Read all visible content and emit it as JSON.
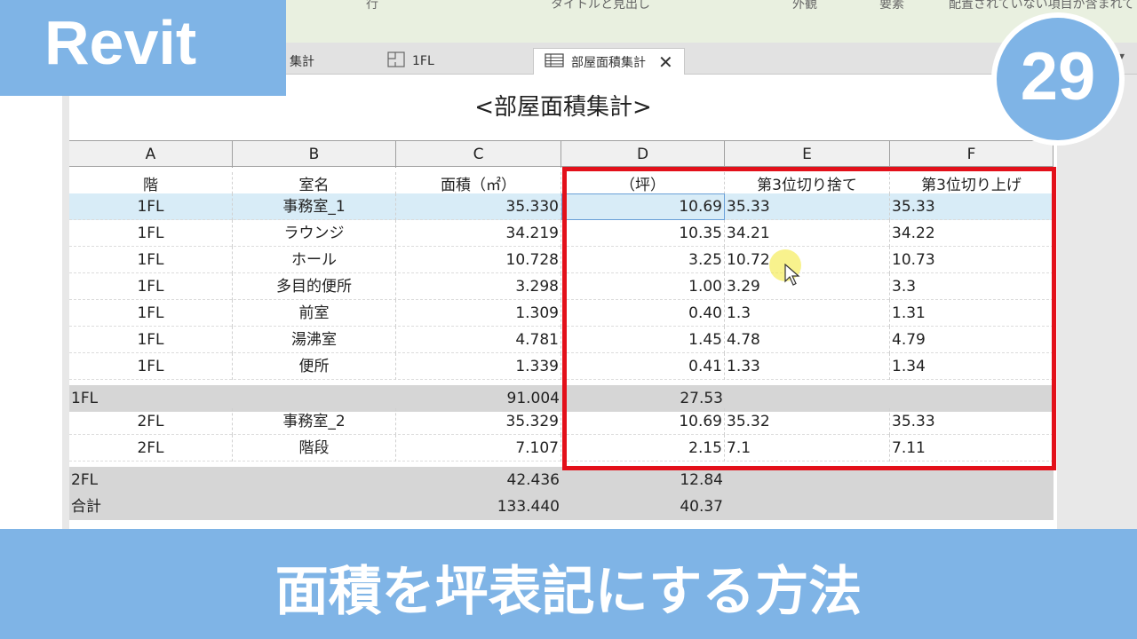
{
  "brand": "Revit",
  "episode": "29",
  "footer_title": "面積を坪表記にする方法",
  "header_strip": [
    "行",
    "タイトルと見出し",
    "外観",
    "要素",
    "配置されていない項目が含まれて"
  ],
  "tabs": [
    {
      "label": "集計",
      "active": false
    },
    {
      "label": "1FL",
      "active": false,
      "icon": "floor-plan-icon"
    },
    {
      "label": "部屋面積集計",
      "active": true,
      "icon": "schedule-table-icon"
    }
  ],
  "schedule": {
    "title": "<部屋面積集計>",
    "column_letters": [
      "A",
      "B",
      "C",
      "D",
      "E",
      "F"
    ],
    "headers": [
      "階",
      "室名",
      "面積（㎡）",
      "（坪）",
      "第3位切り捨て",
      "第3位切り上げ"
    ],
    "rows": [
      [
        "1FL",
        "事務室_1",
        "35.330",
        "10.69",
        "35.33",
        "35.33"
      ],
      [
        "1FL",
        "ラウンジ",
        "34.219",
        "10.35",
        "34.21",
        "34.22"
      ],
      [
        "1FL",
        "ホール",
        "10.728",
        "3.25",
        "10.72",
        "10.73"
      ],
      [
        "1FL",
        "多目的便所",
        "3.298",
        "1.00",
        "3.29",
        "3.3"
      ],
      [
        "1FL",
        "前室",
        "1.309",
        "0.40",
        "1.3",
        "1.31"
      ],
      [
        "1FL",
        "湯沸室",
        "4.781",
        "1.45",
        "4.78",
        "4.79"
      ],
      [
        "1FL",
        "便所",
        "1.339",
        "0.41",
        "1.33",
        "1.34"
      ]
    ],
    "subtotal_1fl": [
      "1FL",
      "91.004",
      "27.53"
    ],
    "rows_2fl": [
      [
        "2FL",
        "事務室_2",
        "35.329",
        "10.69",
        "35.32",
        "35.33"
      ],
      [
        "2FL",
        "階段",
        "7.107",
        "2.15",
        "7.1",
        "7.11"
      ]
    ],
    "subtotal_2fl": [
      "2FL",
      "42.436",
      "12.84"
    ],
    "grand_total": [
      "合計",
      "133.440",
      "40.37"
    ]
  },
  "colors": {
    "accent": "#7fb4e6",
    "highlight_box": "#e3101a",
    "selected_row": "#d8ecf7"
  }
}
